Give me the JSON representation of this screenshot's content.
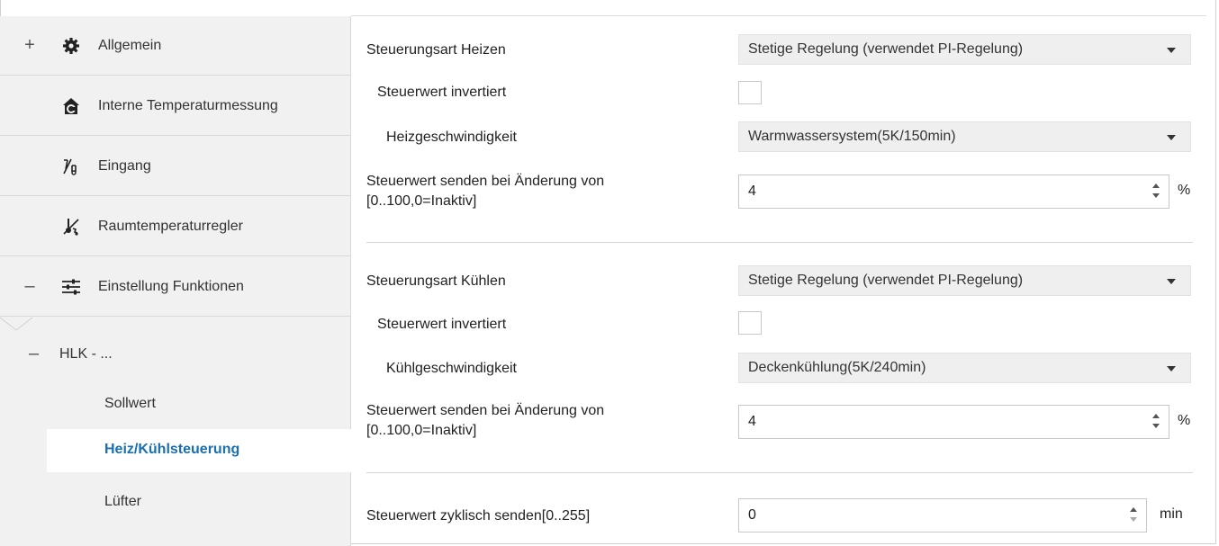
{
  "sidebar": {
    "items": [
      {
        "toggle": "+",
        "icon": "gear-icon",
        "label": "Allgemein"
      },
      {
        "toggle": "",
        "icon": "house-thermometer-icon",
        "label": "Interne Temperaturmessung"
      },
      {
        "toggle": "",
        "icon": "input-switch-icon",
        "label": "Eingang"
      },
      {
        "toggle": "",
        "icon": "room-thermostat-icon",
        "label": "Raumtemperaturregler"
      },
      {
        "toggle": "–",
        "icon": "sliders-icon",
        "label": "Einstellung Funktionen"
      }
    ],
    "sub": {
      "group": {
        "toggle": "–",
        "label": "HLK - ..."
      },
      "children": [
        {
          "label": "Sollwert",
          "active": false
        },
        {
          "label": "Heiz/Kühlsteuerung",
          "active": true
        },
        {
          "label": "Lüfter",
          "active": false
        }
      ]
    }
  },
  "main": {
    "heating": {
      "mode_label": "Steuerungsart Heizen",
      "mode_value": "Stetige Regelung (verwendet PI-Regelung)",
      "inverted_label": "Steuerwert invertiert",
      "inverted_checked": false,
      "speed_label": "Heizgeschwindigkeit",
      "speed_value": "Warmwassersystem(5K/150min)",
      "send_label_1": "Steuerwert senden bei Änderung von",
      "send_label_2": "[0..100,0=Inaktiv]",
      "send_value": "4",
      "send_unit": "%"
    },
    "cooling": {
      "mode_label": "Steuerungsart Kühlen",
      "mode_value": "Stetige Regelung (verwendet PI-Regelung)",
      "inverted_label": "Steuerwert invertiert",
      "inverted_checked": false,
      "speed_label": "Kühlgeschwindigkeit",
      "speed_value": "Deckenkühlung(5K/240min)",
      "send_label_1": "Steuerwert senden bei Änderung von",
      "send_label_2": "[0..100,0=Inaktiv]",
      "send_value": "4",
      "send_unit": "%"
    },
    "cyclic": {
      "label": "Steuerwert zyklisch senden[0..255]",
      "value": "0",
      "unit": "min"
    }
  }
}
